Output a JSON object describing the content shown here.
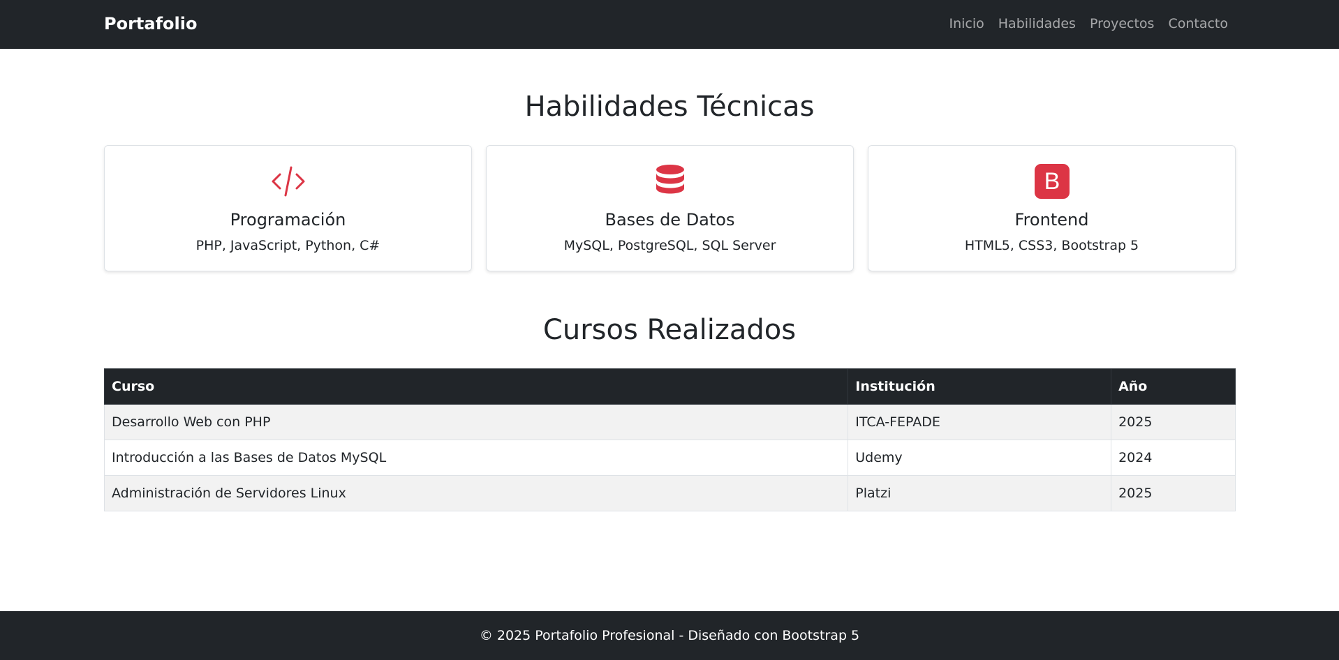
{
  "navbar": {
    "brand": "Portafolio",
    "links": [
      "Inicio",
      "Habilidades",
      "Proyectos",
      "Contacto"
    ]
  },
  "skills": {
    "title": "Habilidades Técnicas",
    "accent_color": "#dc3545",
    "cards": [
      {
        "icon": "code-icon",
        "title": "Programación",
        "text": "PHP, JavaScript, Python, C#"
      },
      {
        "icon": "database-icon",
        "title": "Bases de Datos",
        "text": "MySQL, PostgreSQL, SQL Server"
      },
      {
        "icon": "bootstrap-icon",
        "title": "Frontend",
        "text": "HTML5, CSS3, Bootstrap 5"
      }
    ]
  },
  "courses": {
    "title": "Cursos Realizados",
    "headers": [
      "Curso",
      "Institución",
      "Año"
    ],
    "rows": [
      [
        "Desarrollo Web con PHP",
        "ITCA-FEPADE",
        "2025"
      ],
      [
        "Introducción a las Bases de Datos MySQL",
        "Udemy",
        "2024"
      ],
      [
        "Administración de Servidores Linux",
        "Platzi",
        "2025"
      ]
    ]
  },
  "footer": {
    "text": "© 2025 Portafolio Profesional - Diseñado con Bootstrap 5"
  }
}
